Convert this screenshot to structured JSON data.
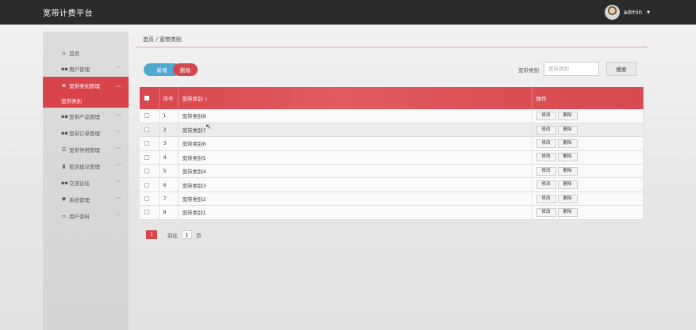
{
  "header": {
    "title": "宽带计费平台",
    "username": "admin"
  },
  "sidebar": {
    "home": "首页",
    "items": [
      {
        "label": "用户管理",
        "icon": "grid-icon",
        "active": false
      },
      {
        "label": "宽带类别管理",
        "icon": "list-icon",
        "active": true,
        "sub": "宽带类别"
      },
      {
        "label": "宽带产品管理",
        "icon": "grid-icon",
        "active": false
      },
      {
        "label": "宽带订单管理",
        "icon": "grid-icon",
        "active": false
      },
      {
        "label": "宽带停用管理",
        "icon": "align-icon",
        "active": false
      },
      {
        "label": "投诉建议管理",
        "icon": "bar-chart-icon",
        "active": false
      },
      {
        "label": "交流论坛",
        "icon": "grid-icon",
        "active": false
      },
      {
        "label": "系统管理",
        "icon": "heart-icon",
        "active": false
      },
      {
        "label": "用户资料",
        "icon": "card-icon",
        "active": false
      }
    ]
  },
  "breadcrumb": "首页 / 宽带类别",
  "toolbar": {
    "add_label": "新增",
    "delete_label": "删除",
    "filter_label": "宽带类别",
    "filter_placeholder": "宽带类别",
    "search_label": "搜索"
  },
  "table": {
    "headers": {
      "no": "序号",
      "name": "宽带类别",
      "ops": "操作"
    },
    "edit_label": "修改",
    "delete_label": "删除",
    "rows": [
      {
        "no": "1",
        "name": "宽带类别8"
      },
      {
        "no": "2",
        "name": "宽带类别7"
      },
      {
        "no": "3",
        "name": "宽带类别6"
      },
      {
        "no": "4",
        "name": "宽带类别5"
      },
      {
        "no": "5",
        "name": "宽带类别4"
      },
      {
        "no": "6",
        "name": "宽带类别3"
      },
      {
        "no": "7",
        "name": "宽带类别2"
      },
      {
        "no": "8",
        "name": "宽带类别1"
      }
    ]
  },
  "pagination": {
    "current": "1",
    "goto_prefix": "前往",
    "goto_value": "1",
    "goto_suffix": "页"
  },
  "colors": {
    "accent": "#d9434a",
    "header_bg": "#2b2b2b",
    "add_button": "#4ea8d0"
  }
}
